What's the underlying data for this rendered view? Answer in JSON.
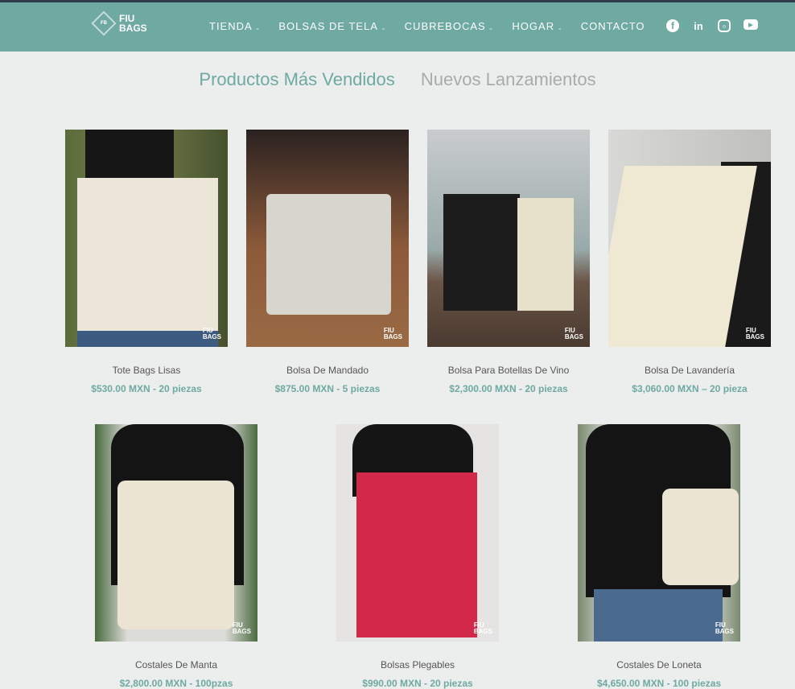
{
  "header": {
    "logo": {
      "mark": "FB",
      "line1": "FIU",
      "line2": "BAGS"
    },
    "nav": [
      {
        "label": "TIENDA",
        "dropdown": true
      },
      {
        "label": "BOLSAS DE TELA",
        "dropdown": true
      },
      {
        "label": "CUBREBOCAS",
        "dropdown": true
      },
      {
        "label": "HOGAR",
        "dropdown": true
      },
      {
        "label": "CONTACTO",
        "dropdown": false
      }
    ],
    "social": [
      "facebook-icon",
      "linkedin-icon",
      "instagram-icon",
      "youtube-icon"
    ]
  },
  "tabs": [
    {
      "label": "Productos Más Vendidos",
      "active": true
    },
    {
      "label": "Nuevos Lanzamientos",
      "active": false
    }
  ],
  "products": [
    {
      "name": "Tote Bags Lisas",
      "price": "$530.00 MXN - 20 piezas"
    },
    {
      "name": "Bolsa De Mandado",
      "price": "$875.00 MXN - 5 piezas"
    },
    {
      "name": "Bolsa Para Botellas De Vino",
      "price": "$2,300.00 MXN - 20 piezas"
    },
    {
      "name": "Bolsa De Lavandería",
      "price": "$3,060.00 MXN – 20 pieza"
    },
    {
      "name": "Costales De Manta",
      "price": "$2,800.00 MXN - 100pzas"
    },
    {
      "name": "Bolsas Plegables",
      "price": "$990.00 MXN - 20 piezas"
    },
    {
      "name": "Costales De Loneta",
      "price": "$4,650.00 MXN - 100 piezas"
    }
  ],
  "colors": {
    "brand": "#6ea9a2",
    "background": "#eceeed"
  }
}
